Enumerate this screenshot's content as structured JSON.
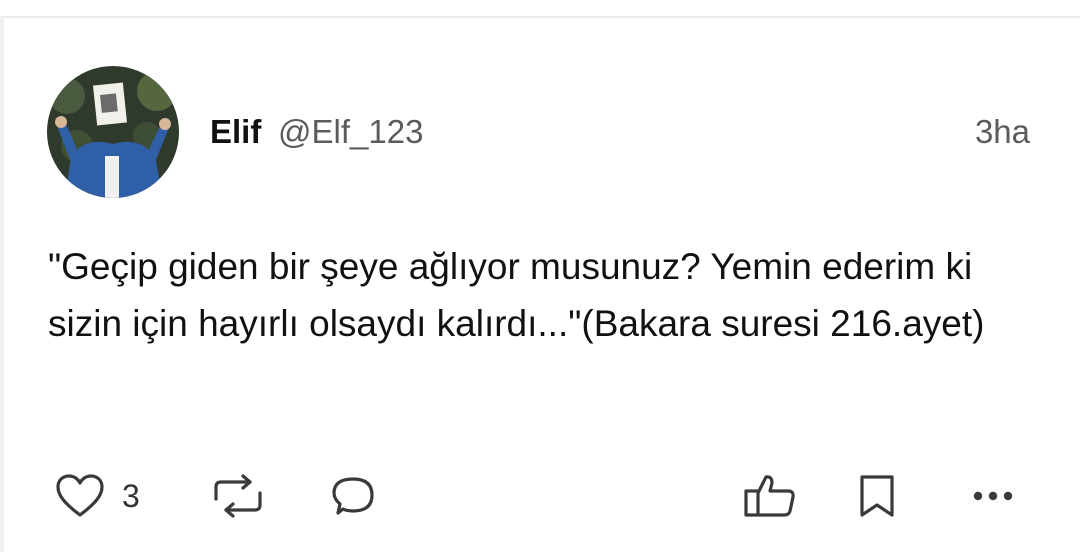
{
  "post": {
    "author_name": "Elif",
    "author_handle": "@Elf_123",
    "time": "3ha",
    "text": "\"Geçip giden bir şeye ağlıyor musunuz? Yemin ederim ki sizin için hayırlı olsaydı kalırdı...\"(Bakara suresi 216.ayet)",
    "avatar_icon": "profile-photo"
  },
  "actions": {
    "like_count": "3",
    "like_icon": "heart-icon",
    "repost_icon": "repost-icon",
    "reply_icon": "comment-bubble-icon",
    "upvote_icon": "thumbs-up-icon",
    "bookmark_icon": "bookmark-icon",
    "more_icon": "more-dots-icon"
  },
  "colors": {
    "text": "#111111",
    "muted": "#5b5b5b",
    "icon": "#3a3a3a"
  }
}
